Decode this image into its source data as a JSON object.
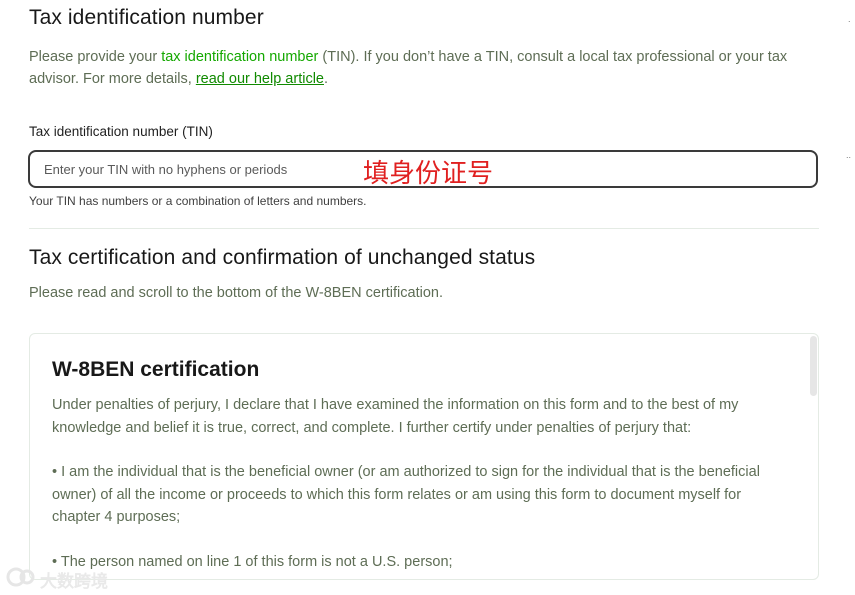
{
  "tin_section": {
    "title": "Tax identification number",
    "intro_before": "Please provide your ",
    "intro_link": "tax identification number",
    "intro_middle": " (TIN). If you don’t have a TIN, consult a local tax professional or your tax advisor. For more details, ",
    "help_link": "read our help article",
    "intro_end": ".",
    "field_label": "Tax identification number (TIN)",
    "placeholder": "Enter your TIN with no hyphens or periods",
    "overlay_note": "填身份证号",
    "hint": "Your TIN has numbers or a combination of letters and numbers."
  },
  "certification_section": {
    "title": "Tax certification and confirmation of unchanged status",
    "subtitle": "Please read and scroll to the bottom of the W-8BEN certification.",
    "box": {
      "title": "W-8BEN certification",
      "paragraphs": [
        "Under penalties of perjury, I declare that I have examined the information on this form and to the best of my knowledge and belief it is true, correct, and complete. I further certify under penalties of perjury that:",
        "• I am the individual that is the beneficial owner (or am authorized to sign for the individual that is the beneficial owner) of all the income or proceeds to which this form relates or am using this form to document myself for chapter 4 purposes;",
        "• The person named on line 1 of this form is not a U.S. person;"
      ]
    }
  },
  "side_marks": [
    ".",
    ".."
  ],
  "watermark": "大数跨境"
}
